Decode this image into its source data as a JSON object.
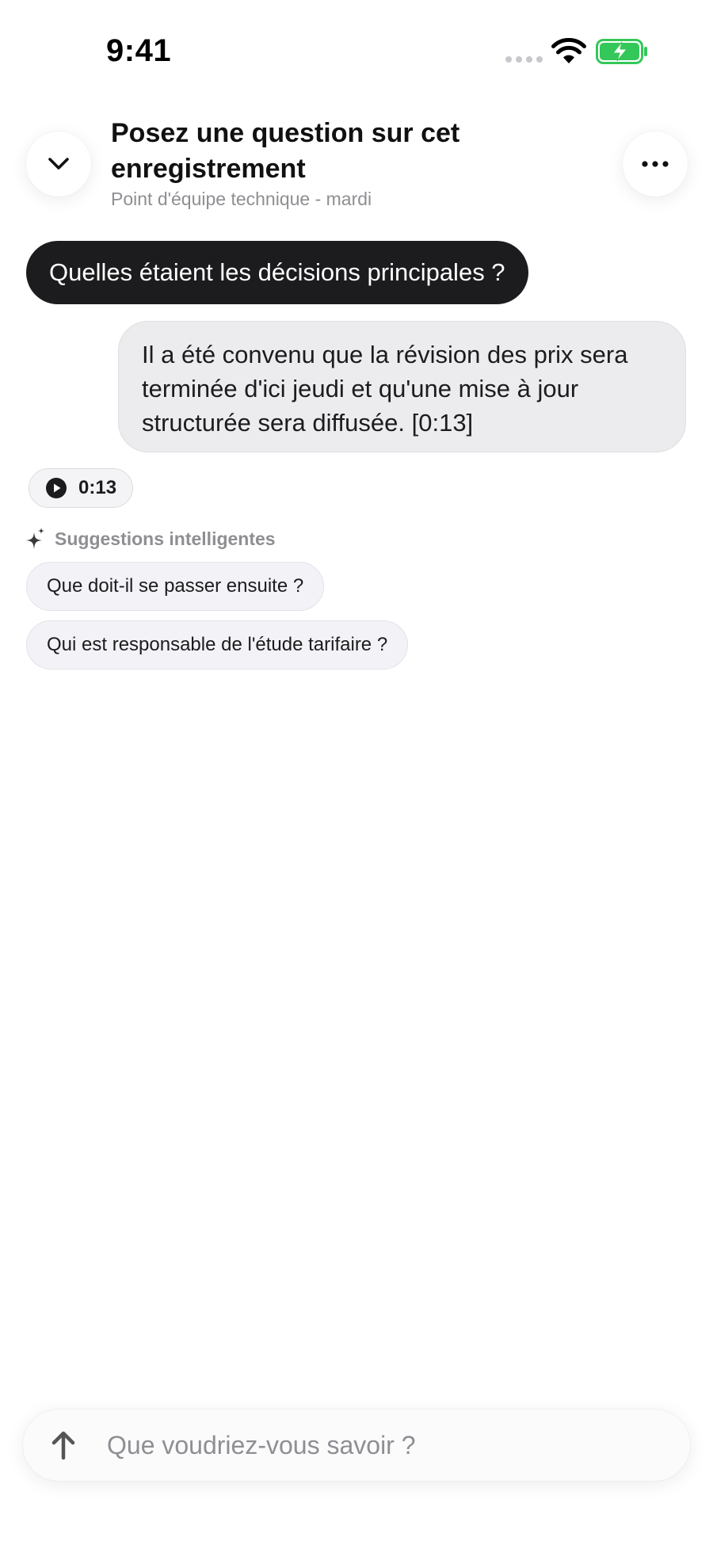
{
  "status_bar": {
    "time": "9:41"
  },
  "header": {
    "title": "Posez une question sur cet enregistrement",
    "subtitle": "Point d'équipe technique - mardi",
    "collapse_icon": "chevron-down-icon",
    "more_icon": "ellipsis-icon"
  },
  "chat": {
    "user_question": "Quelles étaient les décisions principales ?",
    "assistant_answer": "Il a été convenu que la révision des prix sera terminée d'ici jeudi et qu'une mise à jour structurée sera diffusée. [0:13]",
    "timestamp_chip": {
      "label": "0:13",
      "icon": "play-icon"
    }
  },
  "suggestions": {
    "label": "Suggestions intelligentes",
    "icon": "sparkle-icon",
    "items": [
      "Que doit-il se passer ensuite ?",
      "Qui est responsable de l'étude tarifaire ?"
    ]
  },
  "input": {
    "placeholder": "Que voudriez-vous savoir ?",
    "value": "",
    "send_icon": "arrow-up-icon"
  },
  "colors": {
    "question_bubble": "#1c1c1e",
    "answer_bubble": "#ececee",
    "battery_fill": "#34c759",
    "secondary_text": "#8e8e93"
  }
}
